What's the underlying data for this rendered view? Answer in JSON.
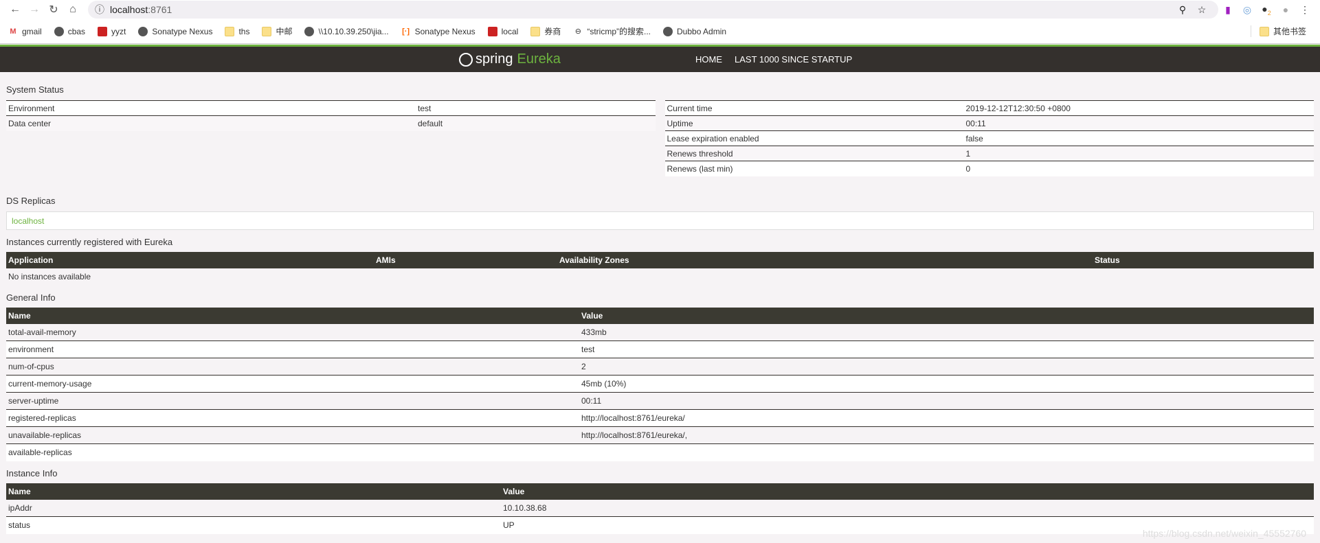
{
  "browser": {
    "url_host": "localhost",
    "url_port": ":8761",
    "badge": "2",
    "bookmarks": [
      "gmail",
      "cbas",
      "yyzt",
      "Sonatype Nexus",
      "ths",
      "中邮",
      "\\\\10.10.39.250\\jia...",
      "Sonatype Nexus",
      "local",
      "券商",
      "“stricmp”的搜索...",
      "Dubbo Admin"
    ],
    "other_bookmarks": "其他书签"
  },
  "nav": {
    "logo_spring": "spring",
    "logo_eureka": "Eureka",
    "home": "HOME",
    "last1000": "LAST 1000 SINCE STARTUP"
  },
  "system_status": {
    "title": "System Status",
    "left": [
      {
        "k": "Environment",
        "v": "test"
      },
      {
        "k": "Data center",
        "v": "default"
      }
    ],
    "right": [
      {
        "k": "Current time",
        "v": "2019-12-12T12:30:50 +0800"
      },
      {
        "k": "Uptime",
        "v": "00:11"
      },
      {
        "k": "Lease expiration enabled",
        "v": "false"
      },
      {
        "k": "Renews threshold",
        "v": "1"
      },
      {
        "k": "Renews (last min)",
        "v": "0"
      }
    ]
  },
  "ds_replicas": {
    "title": "DS Replicas",
    "items": [
      "localhost"
    ]
  },
  "instances": {
    "title": "Instances currently registered with Eureka",
    "headers": [
      "Application",
      "AMIs",
      "Availability Zones",
      "Status"
    ],
    "empty": "No instances available"
  },
  "general_info": {
    "title": "General Info",
    "headers": [
      "Name",
      "Value"
    ],
    "rows": [
      [
        "total-avail-memory",
        "433mb"
      ],
      [
        "environment",
        "test"
      ],
      [
        "num-of-cpus",
        "2"
      ],
      [
        "current-memory-usage",
        "45mb (10%)"
      ],
      [
        "server-uptime",
        "00:11"
      ],
      [
        "registered-replicas",
        "http://localhost:8761/eureka/"
      ],
      [
        "unavailable-replicas",
        "http://localhost:8761/eureka/,"
      ],
      [
        "available-replicas",
        ""
      ]
    ]
  },
  "instance_info": {
    "title": "Instance Info",
    "headers": [
      "Name",
      "Value"
    ],
    "rows": [
      [
        "ipAddr",
        "10.10.38.68"
      ],
      [
        "status",
        "UP"
      ]
    ]
  },
  "watermark": "https://blog.csdn.net/weixin_45552760"
}
